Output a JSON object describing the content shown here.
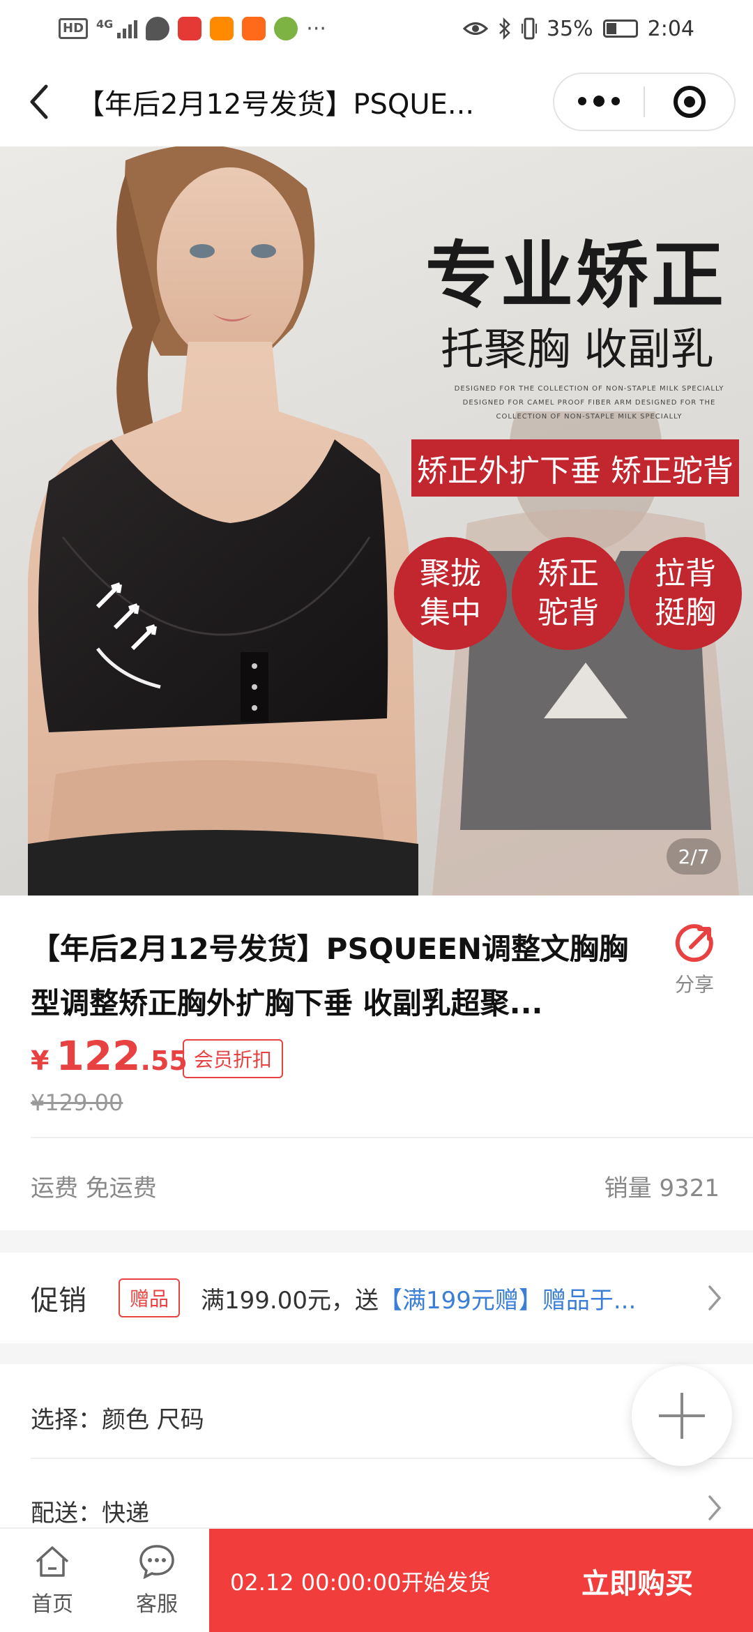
{
  "status_bar": {
    "network": "4G",
    "battery": "35%",
    "time": "2:04"
  },
  "nav": {
    "title": "【年后2月12号发货】PSQUE..."
  },
  "hero": {
    "headline": "专业矫正",
    "subheadline": "托聚胸 收副乳",
    "english_lines": [
      "DESIGNED FOR THE COLLECTION OF NON-STAPLE MILK SPECIALLY",
      "DESIGNED FOR CAMEL PROOF FIBER ARM DESIGNED FOR THE",
      "COLLECTION OF NON-STAPLE MILK SPECIALLY"
    ],
    "tag": "矫正外扩下垂 矫正驼背",
    "circles": [
      {
        "line1": "聚拢",
        "line2": "集中"
      },
      {
        "line1": "矫正",
        "line2": "驼背"
      },
      {
        "line1": "拉背",
        "line2": "挺胸"
      }
    ],
    "counter": "2/7"
  },
  "product": {
    "title": "【年后2月12号发货】PSQUEEN调整文胸胸型调整矫正胸外扩胸下垂 收副乳超聚...",
    "share_label": "分享",
    "currency": "¥",
    "price_int": "122",
    "price_dec": ".55",
    "member_badge": "会员折扣",
    "original_price": "¥129.00",
    "shipping": "运费 免运费",
    "sales": "销量 9321"
  },
  "promo": {
    "label": "促销",
    "badge": "赠品",
    "text": "满199.00元，送",
    "link": "【满199元赠】赠品于..."
  },
  "options": {
    "select": "选择：颜色 尺码",
    "delivery": "配送：快递"
  },
  "bottom_bar": {
    "home": "首页",
    "service": "客服",
    "ship_time": "02.12 00:00:00开始发货",
    "buy": "立即购买"
  },
  "colors": {
    "accent_red": "#f23d3d",
    "price_red": "#e84141",
    "link_blue": "#3a7ed6",
    "hero_red": "#c2262f"
  }
}
